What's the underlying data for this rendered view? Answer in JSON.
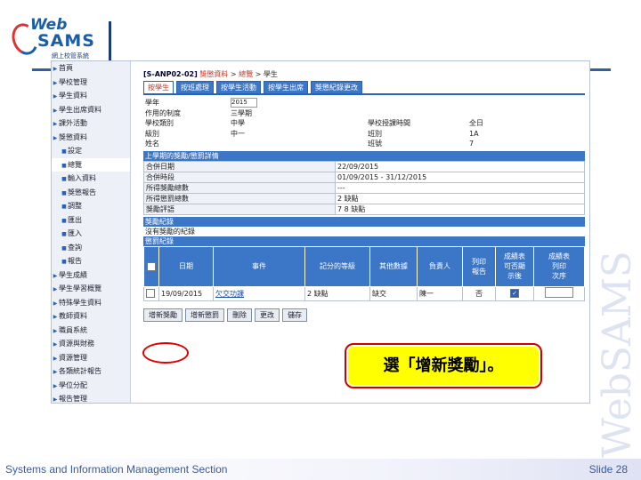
{
  "logo": {
    "web": "Web",
    "sams": "SAMS",
    "subtitle": "網上校管系統"
  },
  "sidebar": {
    "items": [
      {
        "label": "首頁",
        "sub": false
      },
      {
        "label": "學校管理",
        "sub": false
      },
      {
        "label": "學生資料",
        "sub": false
      },
      {
        "label": "學生出席資料",
        "sub": false
      },
      {
        "label": "課外活動",
        "sub": false
      },
      {
        "label": "獎懲資料",
        "sub": false
      },
      {
        "label": "設定",
        "sub": true
      },
      {
        "label": "總覽",
        "sub": true
      },
      {
        "label": "輸入資料",
        "sub": true
      },
      {
        "label": "獎懲報告",
        "sub": true
      },
      {
        "label": "調整",
        "sub": true
      },
      {
        "label": "匯出",
        "sub": true
      },
      {
        "label": "匯入",
        "sub": true
      },
      {
        "label": "查詢",
        "sub": true
      },
      {
        "label": "報告",
        "sub": true
      },
      {
        "label": "學生成績",
        "sub": false
      },
      {
        "label": "學生學習概覽",
        "sub": false
      },
      {
        "label": "特殊學生資料",
        "sub": false
      },
      {
        "label": "教師資料",
        "sub": false
      },
      {
        "label": "職員系統",
        "sub": false
      },
      {
        "label": "資源與財務",
        "sub": false
      },
      {
        "label": "資源管理",
        "sub": false
      },
      {
        "label": "各類統計報告",
        "sub": false
      },
      {
        "label": "學位分配",
        "sub": false
      },
      {
        "label": "報告管理",
        "sub": false
      }
    ]
  },
  "breadcrumb": {
    "code": "[S-ANP02-02]",
    "path1": "獎懲資料",
    "sep": ">",
    "path2": "總覽",
    "current": "學生"
  },
  "tabs": [
    "按學生",
    "按班處理",
    "按學生活動",
    "按學生出席",
    "獎懲紀錄更改"
  ],
  "info": {
    "rows": [
      {
        "l1": "學年",
        "v1": "2015",
        "l2": "",
        "v2": ""
      },
      {
        "l1": "作用的制度",
        "v1": "三學期",
        "l2": "",
        "v2": ""
      },
      {
        "l1": "學校類別",
        "v1": "中學",
        "l2": "學校授課時間",
        "v2": "全日"
      },
      {
        "l1": "級別",
        "v1": "中一",
        "l2": "班別",
        "v2": "1A"
      },
      {
        "l1": "姓名",
        "v1": "",
        "l2": "班號",
        "v2": "7"
      }
    ]
  },
  "section_awards": "上學期的獎勵/懲罰詳情",
  "detail_rows": [
    {
      "label": "合併日期",
      "value": "22/09/2015"
    },
    {
      "label": "合併時段",
      "value": "01/09/2015 - 31/12/2015"
    },
    {
      "label": "所得獎勵總數",
      "value": "---"
    },
    {
      "label": "所得懲罰總數",
      "value": "2 缺點"
    },
    {
      "label": "獎勵評語",
      "value": "7 8 缺點"
    }
  ],
  "section_records": "獎勵紀錄",
  "no_record": "沒有獎勵的紀錄",
  "section_punish": "懲罰紀錄",
  "grid": {
    "headers": [
      "日期",
      "事件",
      "記分的等級",
      "其他數據",
      "負責人",
      "列印\n報告",
      "成績表\n可否顯\n示後",
      "成績表\n列印\n次序"
    ],
    "rows": [
      {
        "date": "19/09/2015",
        "event": "欠交功課",
        "grade": "2 缺點",
        "other": "缺交",
        "person": "陳一",
        "print": "否",
        "checked": true
      }
    ]
  },
  "buttons": [
    "增新獎勵",
    "增新懲罰",
    "刪除",
    "更改",
    "儲存"
  ],
  "callout": "選「增新獎勵」。",
  "footer": {
    "left": "Systems and Information Management Section",
    "right": "Slide 28"
  },
  "watermark": "WebSAMS"
}
